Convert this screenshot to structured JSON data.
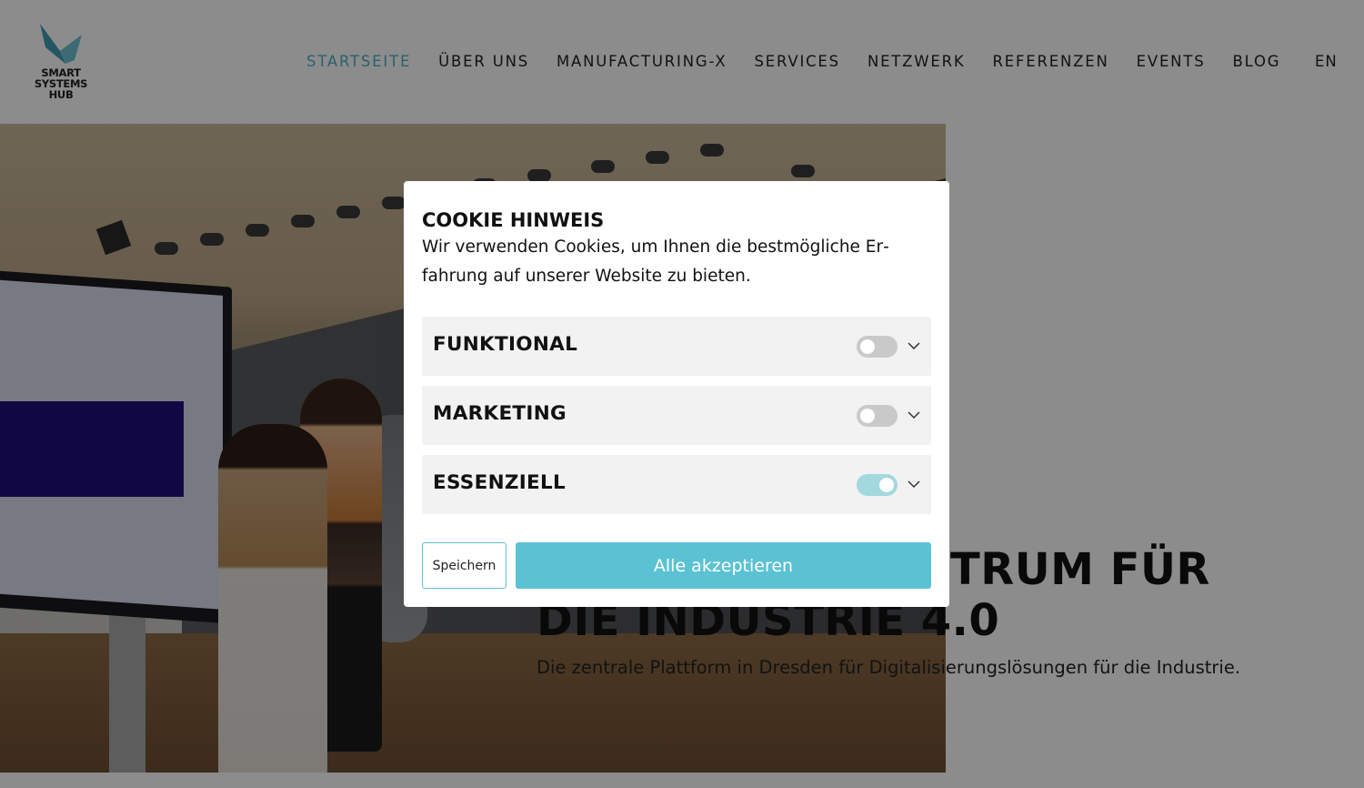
{
  "brand": {
    "logo_lines": [
      "SMART",
      "SYSTEMS",
      "HUB"
    ],
    "logo_color": "#5bb6c8"
  },
  "nav": {
    "items": [
      {
        "label": "STARTSEITE",
        "active": true
      },
      {
        "label": "ÜBER UNS",
        "active": false
      },
      {
        "label": "MANUFACTURING-X",
        "active": false
      },
      {
        "label": "SERVICES",
        "active": false
      },
      {
        "label": "NETZWERK",
        "active": false
      },
      {
        "label": "REFERENZEN",
        "active": false
      },
      {
        "label": "EVENTS",
        "active": false
      },
      {
        "label": "BLOG",
        "active": false
      }
    ],
    "language": "EN"
  },
  "hero": {
    "title_line1": "TRUM FÜR",
    "title_line2": "DIE INDUSTRIE 4.0",
    "subtitle": "Die zentrale Plattform in Dresden für Digitalisierungslösungen für die Industrie."
  },
  "cookie": {
    "title": "COOKIE HINWEIS",
    "text": "Wir verwenden Cookies, um Ihnen die bestmögliche Er­fahrung auf unserer Website zu bieten.",
    "categories": [
      {
        "label": "FUNKTIONAL",
        "enabled": false
      },
      {
        "label": "MARKETING",
        "enabled": false
      },
      {
        "label": "ESSENZIELL",
        "enabled": true
      }
    ],
    "save_label": "Speichern",
    "accept_label": "Alle akzeptieren"
  },
  "colors": {
    "accent": "#5bc2d3",
    "nav_active": "#4fb3c2",
    "toggle_on": "#a3d8df",
    "toggle_off": "#c9c9c9"
  }
}
